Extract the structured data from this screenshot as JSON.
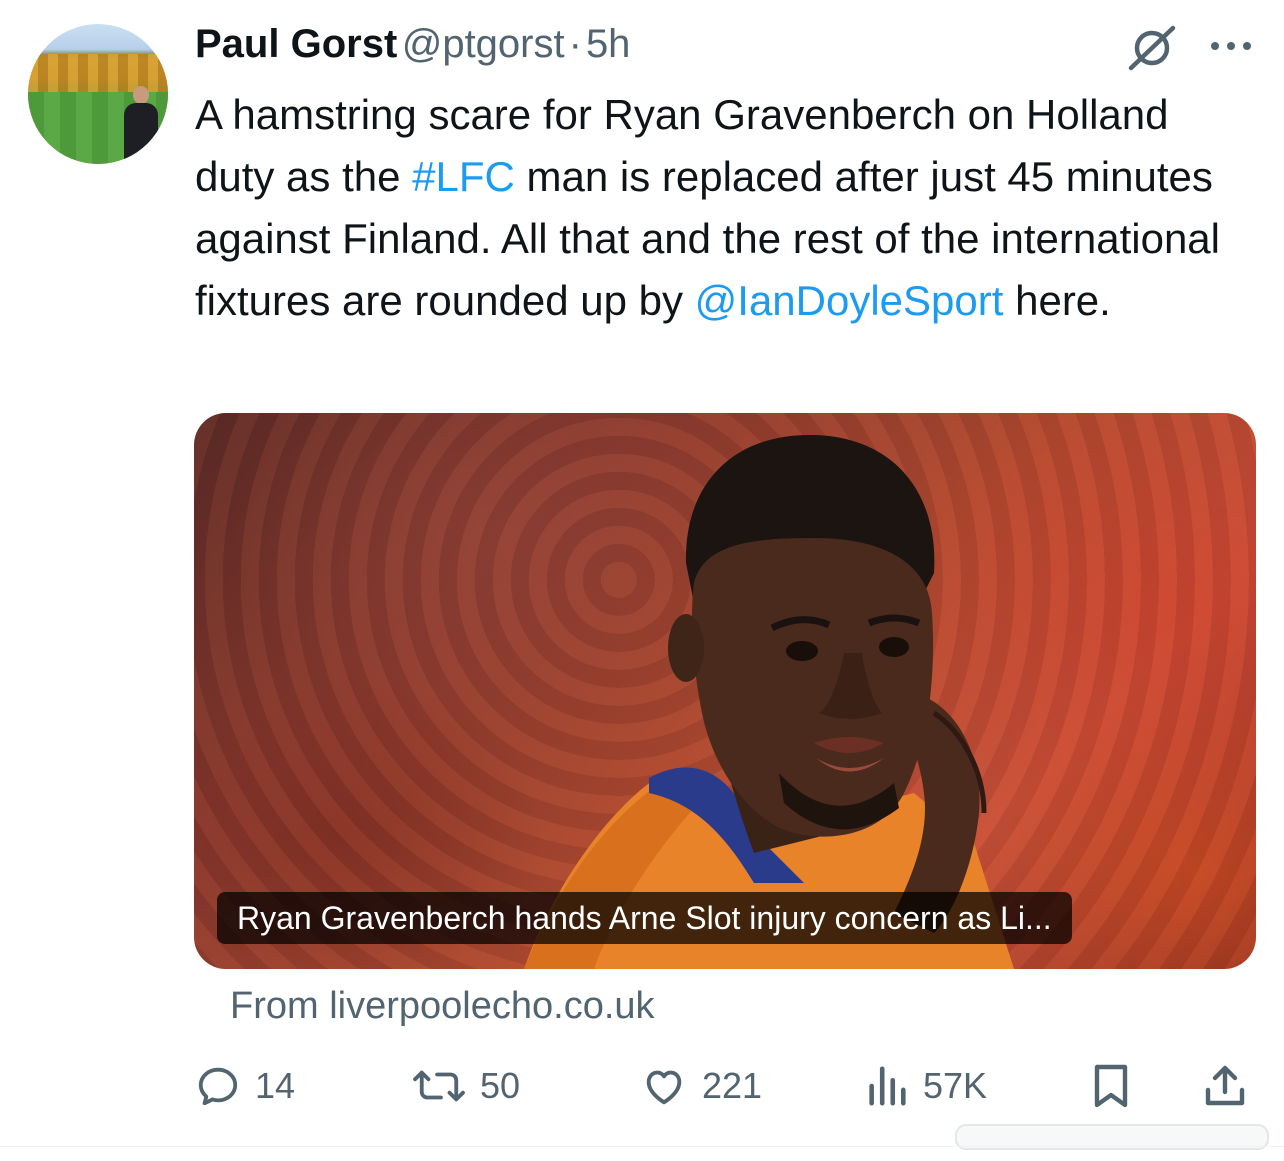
{
  "author": {
    "name": "Paul Gorst",
    "handle": "@ptgorst",
    "separator": "·",
    "time": "5h"
  },
  "tweet": {
    "segments": [
      {
        "text": "A hamstring scare for Ryan Gravenberch on Holland duty as the ",
        "type": "text"
      },
      {
        "text": "#LFC",
        "type": "hashtag"
      },
      {
        "text": " man is replaced after just 45 minutes against Finland. All that and the rest of the international fixtures are rounded up by ",
        "type": "text"
      },
      {
        "text": "@IanDoyleSport",
        "type": "mention"
      },
      {
        "text": " here.",
        "type": "text"
      }
    ]
  },
  "card": {
    "caption": "Ryan Gravenberch hands Arne Slot injury concern as Li...",
    "source": "From liverpoolecho.co.uk"
  },
  "actions": {
    "replies": "14",
    "reposts": "50",
    "likes": "221",
    "views": "57K"
  },
  "colors": {
    "link": "#1d9bf0",
    "secondary_text": "#536471",
    "primary_text": "#0f1419"
  },
  "icons": [
    "grok-icon",
    "more-icon",
    "reply-icon",
    "repost-icon",
    "like-icon",
    "views-icon",
    "bookmark-icon",
    "share-icon"
  ]
}
